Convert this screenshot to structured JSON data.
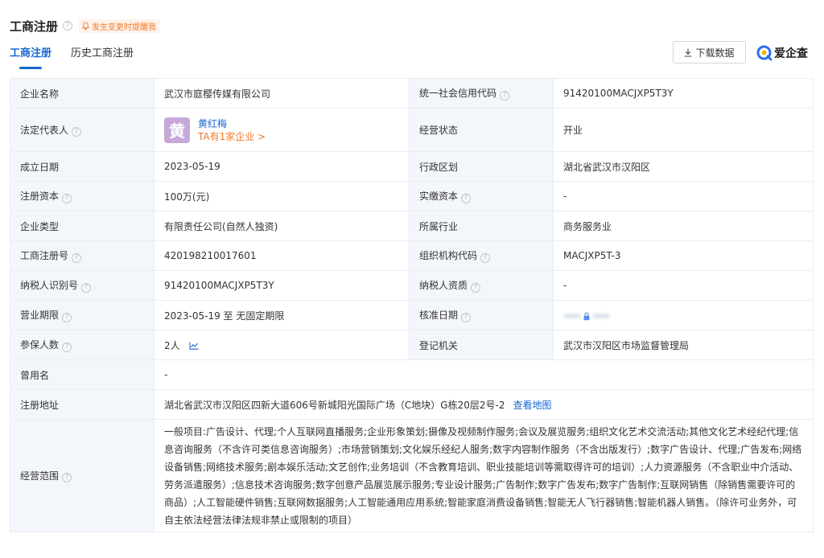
{
  "header": {
    "title": "工商注册",
    "help_glyph": "?",
    "alert_label": "发生变更时提醒我",
    "download_label": "下载数据",
    "logo_text": "爱企查"
  },
  "tabs": [
    {
      "label": "工商注册",
      "active": true
    },
    {
      "label": "历史工商注册",
      "active": false
    }
  ],
  "colors": {
    "accent": "#1867d2",
    "warning": "#f07a2b",
    "label_bg": "#f3f6fb",
    "avatar_bg": "#c5a8d8"
  },
  "fields": {
    "company_name": {
      "label": "企业名称",
      "value": "武汉市庭樱传媒有限公司"
    },
    "credit_code": {
      "label": "统一社会信用代码",
      "value": "91420100MACJXP5T3Y"
    },
    "legal_rep": {
      "label": "法定代表人",
      "avatar": "黄",
      "name": "黄红梅",
      "companies": "TA有1家企业 >"
    },
    "status": {
      "label": "经营状态",
      "value": "开业"
    },
    "founded": {
      "label": "成立日期",
      "value": "2023-05-19"
    },
    "region": {
      "label": "行政区划",
      "value": "湖北省武汉市汉阳区"
    },
    "reg_capital": {
      "label": "注册资本",
      "value": "100万(元)"
    },
    "paid_capital": {
      "label": "实缴资本",
      "value": "-"
    },
    "company_type": {
      "label": "企业类型",
      "value": "有限责任公司(自然人独资)"
    },
    "industry": {
      "label": "所属行业",
      "value": "商务服务业"
    },
    "reg_number": {
      "label": "工商注册号",
      "value": "420198210017601"
    },
    "org_code": {
      "label": "组织机构代码",
      "value": "MACJXP5T-3"
    },
    "taxpayer_id": {
      "label": "纳税人识别号",
      "value": "91420100MACJXP5T3Y"
    },
    "taxpayer_qual": {
      "label": "纳税人资质",
      "value": "-"
    },
    "term": {
      "label": "营业期限",
      "value": "2023-05-19 至 无固定期限"
    },
    "approval_date": {
      "label": "核准日期"
    },
    "insured": {
      "label": "参保人数",
      "value": "2人"
    },
    "authority": {
      "label": "登记机关",
      "value": "武汉市汉阳区市场监督管理局"
    },
    "former_name": {
      "label": "曾用名",
      "value": "-"
    },
    "address": {
      "label": "注册地址",
      "value": "湖北省武汉市汉阳区四新大道606号新城阳光国际广场（C地块）G栋20层2号-2",
      "map_link": "查看地图"
    },
    "scope": {
      "label": "经营范围",
      "value": "一般项目:广告设计、代理;个人互联网直播服务;企业形象策划;摄像及视频制作服务;会议及展览服务;组织文化艺术交流活动;其他文化艺术经纪代理;信息咨询服务（不含许可类信息咨询服务）;市场营销策划;文化娱乐经纪人服务;数字内容制作服务（不含出版发行）;数字广告设计、代理;广告发布;网络设备销售;网络技术服务;剧本娱乐活动;文艺创作;业务培训（不含教育培训、职业技能培训等需取得许可的培训）;人力资源服务（不含职业中介活动、劳务派遣服务）;信息技术咨询服务;数字创意产品展览展示服务;专业设计服务;广告制作;数字广告发布;数字广告制作;互联网销售（除销售需要许可的商品）;人工智能硬件销售;互联网数据服务;人工智能通用应用系统;智能家庭消费设备销售;智能无人飞行器销售;智能机器人销售。（除许可业务外，可自主依法经营法律法规非禁止或限制的项目）"
    }
  }
}
